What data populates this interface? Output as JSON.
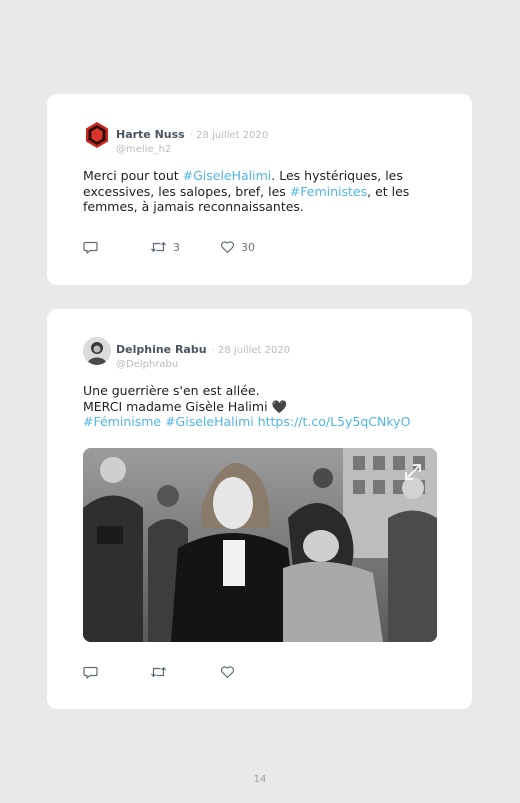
{
  "tweets": [
    {
      "author": "Harte Nuss",
      "date": "· 28 juillet 2020",
      "handle": "@melie_h2",
      "text": [
        {
          "t": "Merci pour tout ",
          "tag": false
        },
        {
          "t": "#GiseleHalimi",
          "tag": true
        },
        {
          "t": ". Les hystériques, les excessives, les salopes, bref, les ",
          "tag": false
        },
        {
          "t": "#Feministes",
          "tag": true
        },
        {
          "t": ", et les femmes, à jamais reconnaissantes.",
          "tag": false
        }
      ],
      "retweets": "3",
      "likes": "30"
    },
    {
      "author": "Delphine Rabu",
      "date": "· 28 juillet 2020",
      "handle": "@Delphrabu",
      "line1": "Une guerrière s'en est allée.",
      "line2": "MERCI madame Gisèle Halimi ",
      "heart": "🖤",
      "hashtags": "#Féminisme #GiseleHalimi https://t.co/L5y5qCNkyO"
    }
  ],
  "icons": {
    "reply": "reply-icon",
    "retweet": "retweet-icon",
    "like": "heart-icon",
    "expand": "expand-icon"
  },
  "colors": {
    "link": "#4fb5e8",
    "name": "#4a5560",
    "muted": "#b7bcc2"
  },
  "page_number": "14"
}
